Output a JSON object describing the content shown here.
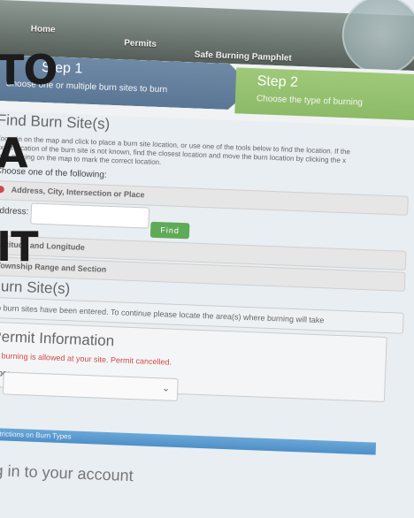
{
  "nav": {
    "home": "Home",
    "permits": "Permits",
    "pamphlet": "Safe Burning Pamphlet"
  },
  "steps": {
    "step1_title": "Step 1",
    "step1_sub": "Choose one or multiple burn sites to burn",
    "step2_title": "Step 2",
    "step2_sub": "Choose the type of burning"
  },
  "find_site": {
    "heading": "Find Burn Site(s)",
    "instructions": [
      "Zoom in on the map and click to place a burn site location, or use one of the tools below to find the location. If the",
      "exact location of the burn site is not known, find the closest location and move the burn location by clicking the x",
      "then clicking on the map to mark the correct location."
    ],
    "choose": "Choose one of the following:",
    "option_address": "Address, City, Intersection or Place",
    "address_label": "Address:",
    "find_button": "Find",
    "option_latlong": "Latitude and Longitude",
    "option_township": "Township Range and Section"
  },
  "burn_sites": {
    "heading": "Burn Site(s)",
    "message": "No burn sites have been entered. To continue please locate the area(s) where burning will take"
  },
  "permit_info": {
    "heading": "Permit Information",
    "warning": "No burning is allowed at your site. Permit cancelled.",
    "type_label": "Type:",
    "select_value": ""
  },
  "restrictions": {
    "label": "Restrictions on Burn Types"
  },
  "account": {
    "text": "Log in to your account"
  },
  "overlay": {
    "line1": "TO",
    "line2": "A",
    "line3": "IT"
  },
  "colors": {
    "step1": "#5a7695",
    "step2": "#8cba67",
    "find": "#5faa57",
    "warning": "#d04a4a"
  }
}
